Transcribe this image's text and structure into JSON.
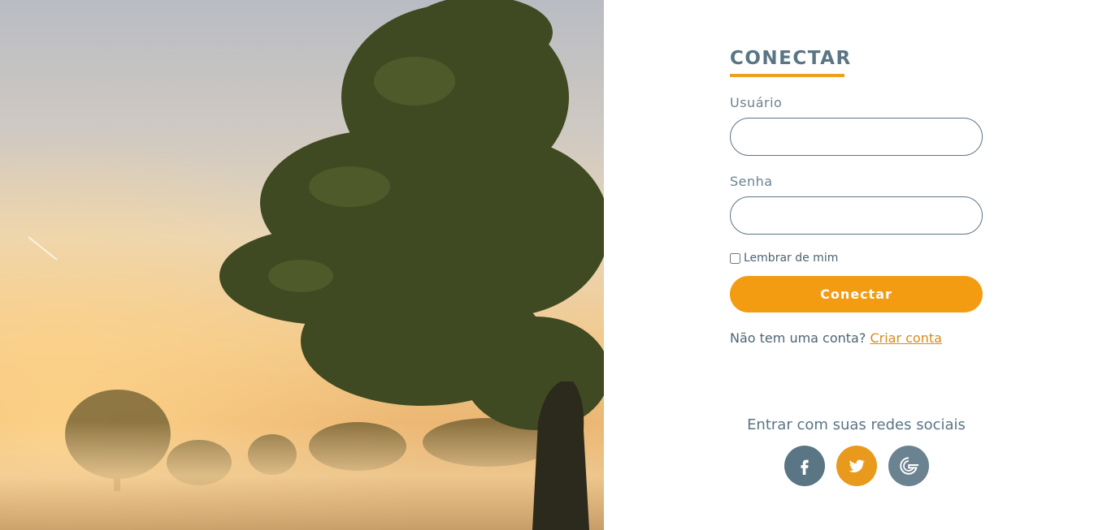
{
  "login": {
    "title": "CONECTAR",
    "username_label": "Usuário",
    "username_value": "",
    "password_label": "Senha",
    "password_value": "",
    "remember_label": "Lembrar de mim",
    "remember_checked": false,
    "submit_label": "Conectar",
    "signup_prompt": "Não tem uma conta?",
    "signup_link": "Criar conta"
  },
  "social": {
    "title": "Entrar com suas redes sociais",
    "buttons": [
      {
        "icon": "facebook-icon",
        "color": "#5a7584"
      },
      {
        "icon": "twitter-icon",
        "color": "#e99a1c"
      },
      {
        "icon": "google-icon",
        "color": "#6b8290"
      }
    ]
  },
  "colors": {
    "accent": "#f39c12",
    "primary": "#5a7584"
  }
}
